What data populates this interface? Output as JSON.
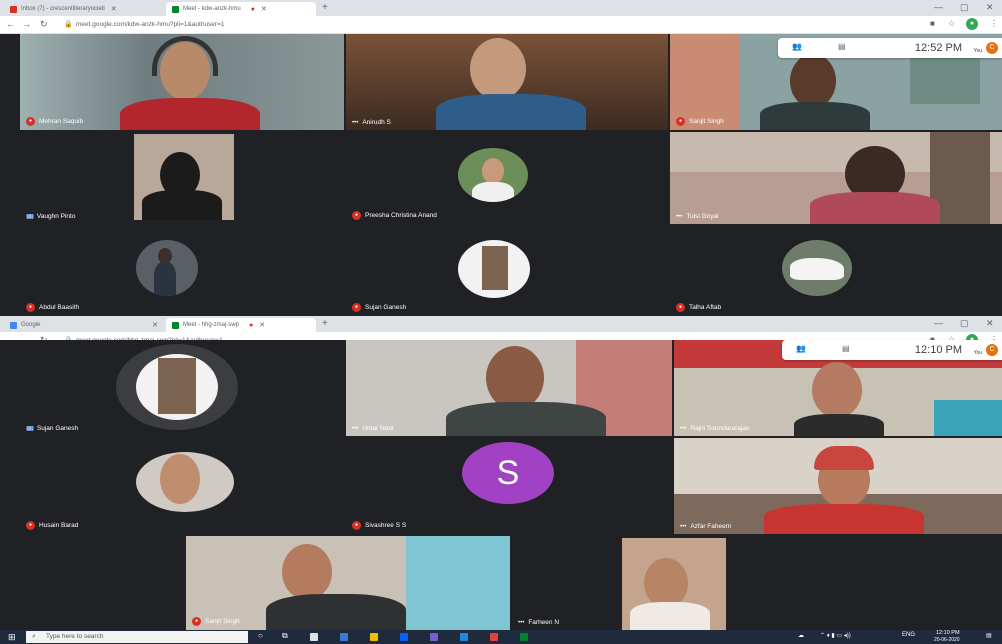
{
  "top": {
    "tabs": [
      {
        "label": "Inbox (7) - crescentliteraryocieti",
        "icon": "gmail-icon",
        "color": "#d93025"
      },
      {
        "label": "Meet - kdw-anzk-hmu",
        "icon": "meet-icon",
        "color": "#00832d"
      }
    ],
    "url": "meet.google.com/kdw-anzk-hmu?pli=1&authuser=1",
    "time": "12:52 PM",
    "you_label": "You",
    "tiles": [
      {
        "name": "Mehran Saquib",
        "status": "muted"
      },
      {
        "name": "Anirudh S",
        "status": "dots"
      },
      {
        "name": "Sanjit Singh",
        "status": "muted"
      },
      {
        "name": "Vaughn Pinto",
        "status": "speaking"
      },
      {
        "name": "Preesha Christina Anand",
        "status": "muted"
      },
      {
        "name": "Tulsi Goyal",
        "status": "dots"
      },
      {
        "name": "Abdul Baasith",
        "status": "muted"
      },
      {
        "name": "Sujan Ganesh",
        "status": "muted"
      },
      {
        "name": "Talha Aftab",
        "status": "muted"
      }
    ]
  },
  "bottom": {
    "tabs": [
      {
        "label": "Google",
        "icon": "google-icon",
        "color": "#4285f4"
      },
      {
        "label": "Meet - hhg-zmaj-swp",
        "icon": "meet-icon",
        "color": "#00832d"
      }
    ],
    "url": "meet.google.com/hhg-zmaj-swp?pli=1&authuser=1",
    "time": "12:10 PM",
    "you_label": "You",
    "tiles": [
      {
        "name": "Sujan Ganesh",
        "status": "speaking"
      },
      {
        "name": "Umar Noor",
        "status": "dots"
      },
      {
        "name": "Rajni Soundararajan",
        "status": "dots"
      },
      {
        "name": "Husain Barad",
        "status": "muted"
      },
      {
        "name": "Sivashree S S",
        "status": "muted",
        "initial": "S"
      },
      {
        "name": "Azfar Faheem",
        "status": "dots"
      },
      {
        "name": "Sanjit Singh",
        "status": "muted"
      },
      {
        "name": "Farheen N",
        "status": "dots"
      }
    ]
  },
  "taskbar": {
    "search_placeholder": "Type here to search",
    "lang": "ENG",
    "time": "12:10 PM",
    "date": "20-06-2020"
  },
  "colors": {
    "meet_bg": "#202124",
    "muted_red": "#d93025",
    "avatar_purple": "#a142c4",
    "you_orange": "#e8710a"
  }
}
